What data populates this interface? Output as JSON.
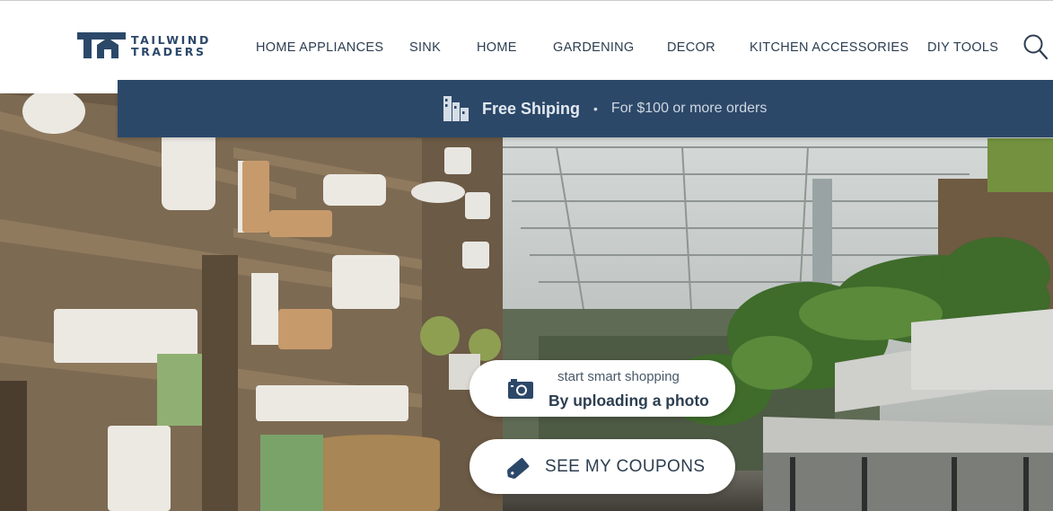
{
  "brand": {
    "line1": "TAILWIND",
    "line2": "TRADERS"
  },
  "nav": {
    "items": [
      {
        "label": "HOME APPLIANCES"
      },
      {
        "label": "SINK"
      },
      {
        "label": "HOME"
      },
      {
        "label": "GARDENING"
      },
      {
        "label": "DECOR"
      },
      {
        "label": "KITCHEN ACCESSORIES"
      },
      {
        "label": "DIY TOOLS"
      }
    ],
    "search_icon": "search-icon"
  },
  "banner": {
    "title": "Free Shiping",
    "separator": "•",
    "subtitle": "For $100 or more orders",
    "icon": "building-icon",
    "background": "#2c4869"
  },
  "hero": {
    "upload": {
      "small": "start smart shopping",
      "big": "By uploading a photo",
      "icon": "camera-icon"
    },
    "coupons": {
      "label": "SEE MY COUPONS",
      "icon": "tag-icon"
    }
  },
  "colors": {
    "brand": "#2c4869",
    "text": "#2c3e50"
  }
}
